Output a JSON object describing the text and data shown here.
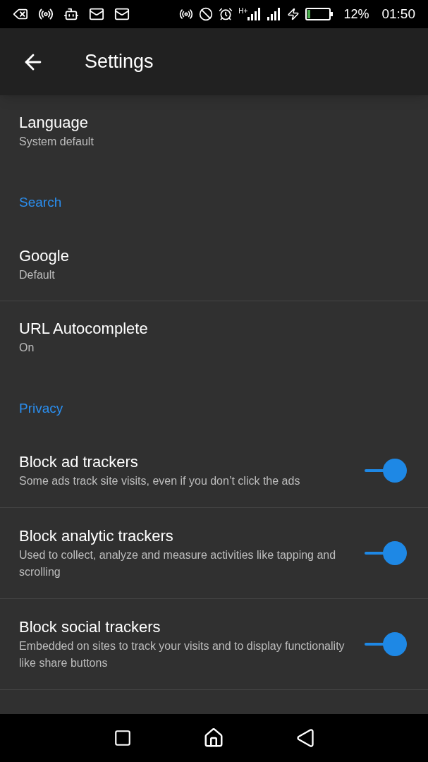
{
  "status_bar": {
    "network": "H+",
    "battery": "12%",
    "time": "01:50"
  },
  "toolbar": {
    "title": "Settings"
  },
  "items": [
    {
      "kind": "pref",
      "title": "Language",
      "summary": "System default",
      "divider": false
    },
    {
      "kind": "header",
      "title": "Search",
      "divider": false
    },
    {
      "kind": "pref",
      "title": "Google",
      "summary": "Default",
      "divider": true
    },
    {
      "kind": "pref",
      "title": "URL Autocomplete",
      "summary": "On",
      "divider": false
    },
    {
      "kind": "header",
      "title": "Privacy",
      "divider": false
    },
    {
      "kind": "toggle",
      "title": "Block ad trackers",
      "summary": "Some ads track site visits, even if you don’t click the ads",
      "on": true,
      "divider": true
    },
    {
      "kind": "toggle",
      "title": "Block analytic trackers",
      "summary": "Used to collect, analyze and measure activities like tapping and scrolling",
      "on": true,
      "divider": true
    },
    {
      "kind": "toggle",
      "title": "Block social trackers",
      "summary": "Embedded on sites to track your visits and to display functionality like share buttons",
      "on": true,
      "divider": true
    }
  ]
}
